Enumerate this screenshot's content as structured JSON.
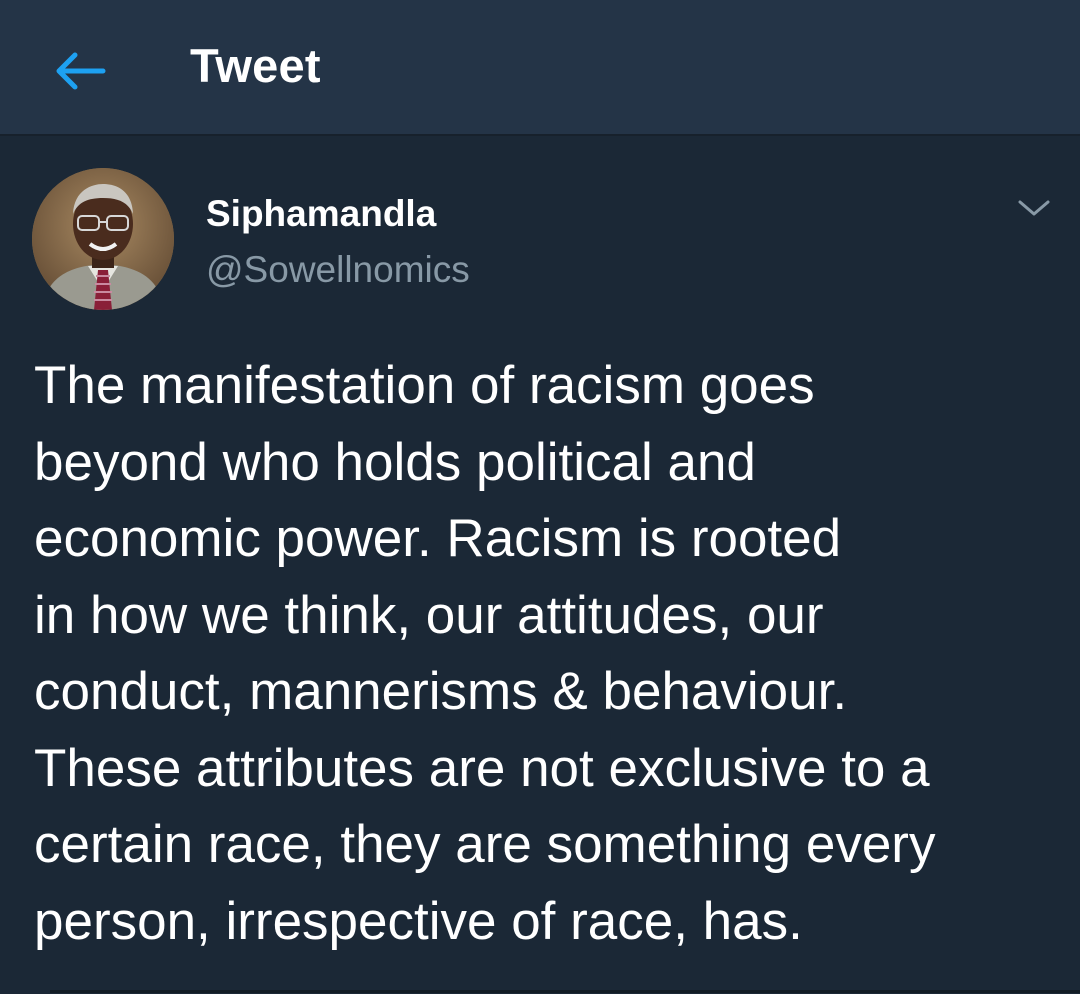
{
  "header": {
    "back_icon": "back-arrow-icon",
    "title": "Tweet",
    "accent_color": "#1da1f2"
  },
  "tweet": {
    "author": {
      "display_name": "Siphamandla",
      "handle": "@Sowellnomics",
      "avatar_icon": "avatar-photo"
    },
    "menu_icon": "chevron-down-icon",
    "text": "The manifestation of racism goes\nbeyond who holds political and\neconomic power. Racism is rooted\nin how we think, our attitudes, our\nconduct, mannerisms & behaviour.\nThese attributes are not exclusive to a\ncertain race, they are something every\nperson, irrespective of race, has."
  },
  "colors": {
    "background": "#1b2836",
    "header_background": "#243447",
    "secondary_text": "#8899a6"
  }
}
